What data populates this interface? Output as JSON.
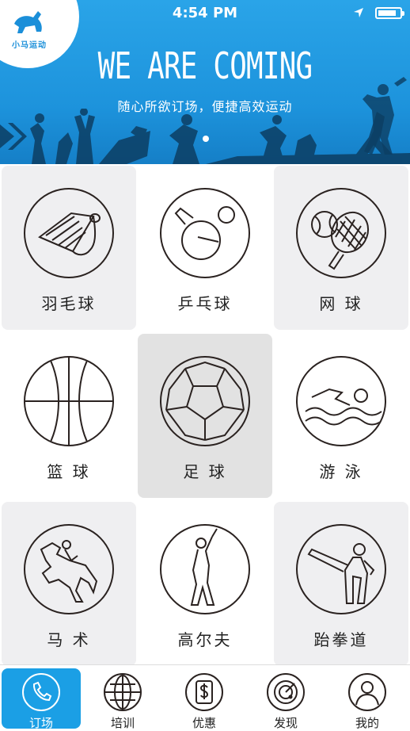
{
  "status_bar": {
    "time": "4:54 PM",
    "battery_level": 0.85
  },
  "banner": {
    "logo_text": "小马运动",
    "headline": "WE ARE COMING",
    "subhead": "随心所欲订场，便捷高效运动"
  },
  "sports": [
    {
      "label": "羽毛球",
      "icon": "badminton-icon"
    },
    {
      "label": "乒乓球",
      "icon": "table-tennis-icon"
    },
    {
      "label": "网 球",
      "icon": "tennis-icon"
    },
    {
      "label": "篮 球",
      "icon": "basketball-icon"
    },
    {
      "label": "足 球",
      "icon": "soccer-icon"
    },
    {
      "label": "游 泳",
      "icon": "swimming-icon"
    },
    {
      "label": "马 术",
      "icon": "equestrian-icon"
    },
    {
      "label": "高尔夫",
      "icon": "golf-icon"
    },
    {
      "label": "跆拳道",
      "icon": "taekwondo-icon"
    }
  ],
  "tabs": [
    {
      "label": "订场",
      "icon": "phone-icon",
      "active": true
    },
    {
      "label": "培训",
      "icon": "globe-icon",
      "active": false
    },
    {
      "label": "优惠",
      "icon": "dollar-icon",
      "active": false
    },
    {
      "label": "发现",
      "icon": "radar-icon",
      "active": false
    },
    {
      "label": "我的",
      "icon": "user-icon",
      "active": false
    }
  ],
  "colors": {
    "brand_blue": "#1b9fe5",
    "tile_gray": "#efeff1",
    "tile_highlight": "#e2e2e2",
    "line": "#2a2220"
  }
}
